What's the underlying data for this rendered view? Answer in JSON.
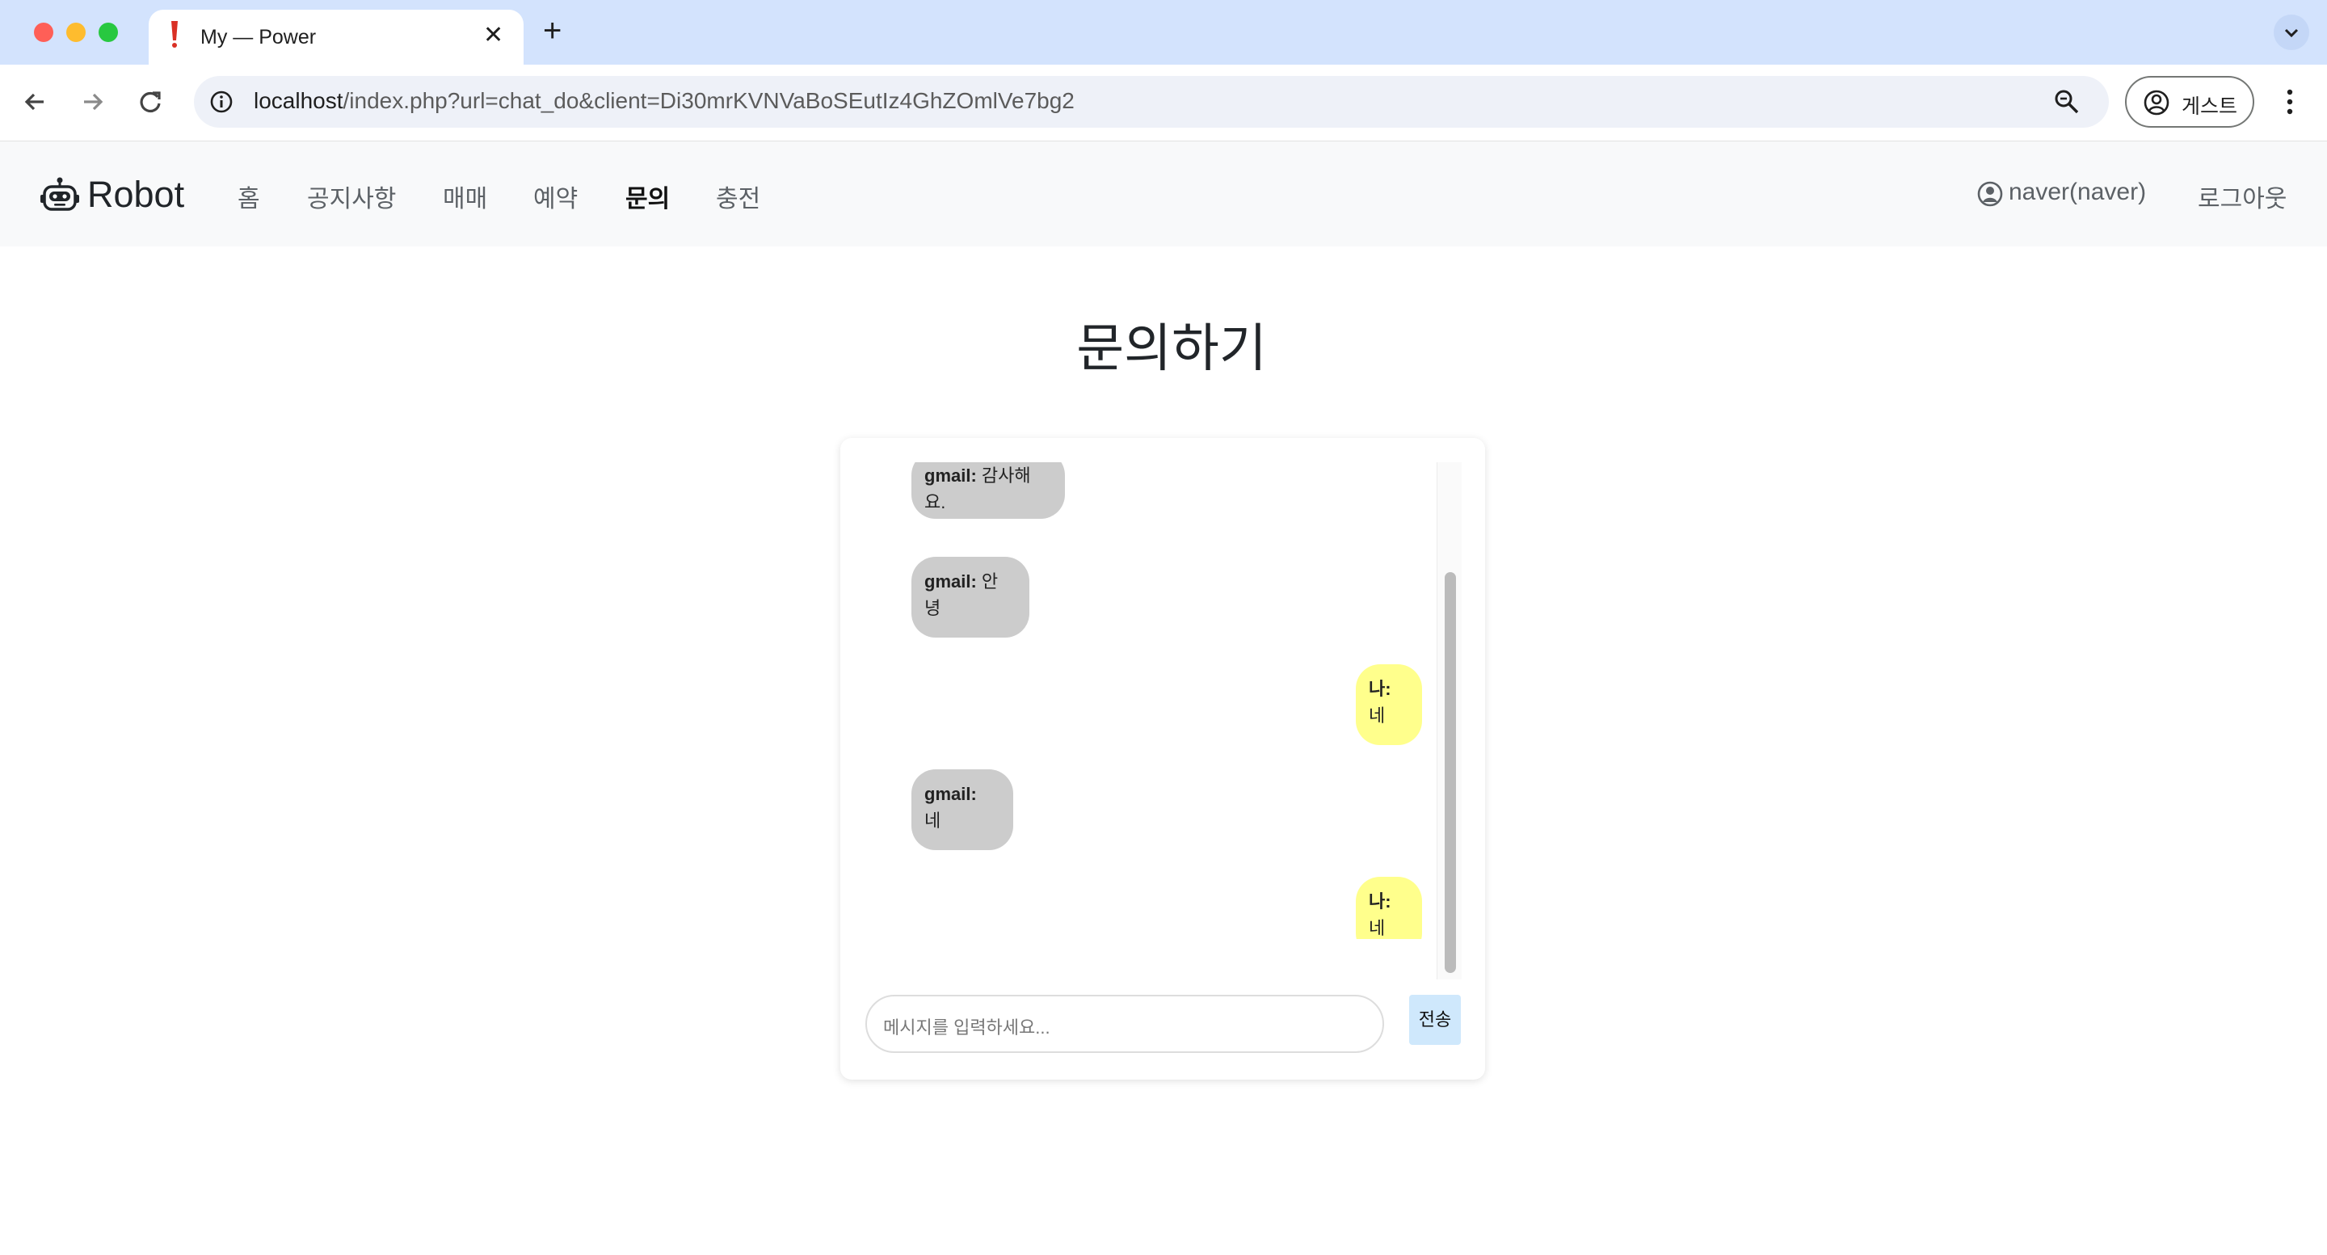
{
  "browser": {
    "tab_title": "My — Power",
    "close_glyph": "✕",
    "new_tab_glyph": "+",
    "url_host": "localhost",
    "url_path": "/index.php?url=chat_do&client=Di30mrKVNVaBoSEutIz4GhZOmlVe7bg2",
    "profile_label": "게스트"
  },
  "nav": {
    "brand": "Robot",
    "items": [
      "홈",
      "공지사항",
      "매매",
      "예약",
      "문의",
      "충전"
    ],
    "active_index": 4,
    "user": "naver(naver)",
    "logout": "로그아웃"
  },
  "page": {
    "title": "문의하기"
  },
  "chat": {
    "messages": [
      {
        "sender": "other",
        "name": "gmail:",
        "line1": "감사해",
        "line2": "요."
      },
      {
        "sender": "other",
        "name": "gmail:",
        "line1": "안",
        "line2": "녕"
      },
      {
        "sender": "me",
        "name": "나:",
        "line1": "",
        "line2": "네"
      },
      {
        "sender": "other",
        "name": "gmail:",
        "line1": "",
        "line2": "네"
      },
      {
        "sender": "me",
        "name": "나:",
        "line1": "",
        "line2": "네"
      }
    ],
    "input_placeholder": "메시지를 입력하세요...",
    "send_label": "전송"
  },
  "colors": {
    "tab_strip": "#d3e3fd",
    "other_bubble": "#cccccc",
    "my_bubble": "#ffff8c",
    "send_button": "#cfe8fc"
  },
  "icons": [
    "robot-icon",
    "user-circle-icon",
    "info-icon",
    "zoom-icon",
    "back-arrow-icon",
    "forward-arrow-icon",
    "reload-icon",
    "kebab-menu-icon"
  ]
}
